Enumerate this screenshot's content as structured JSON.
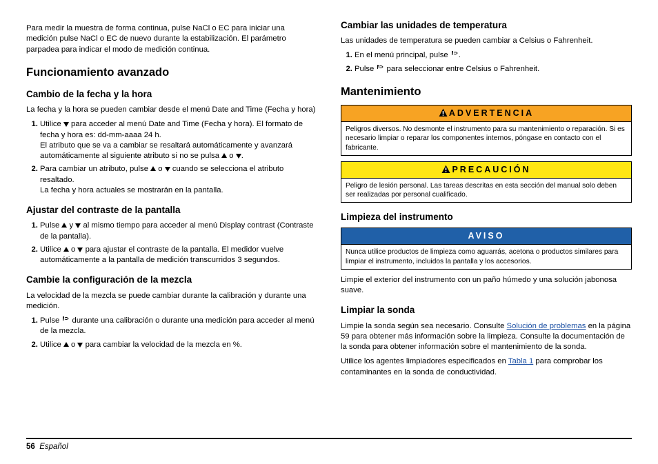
{
  "left": {
    "intro": "Para medir la muestra de forma continua, pulse NaCl o EC para iniciar una medición pulse NaCl o EC de nuevo durante la estabilización. El parámetro parpadea para indicar el modo de medición continua.",
    "h1": "Funcionamiento avanzado",
    "sec1": {
      "title": "Cambio de la fecha y la hora",
      "p1": "La fecha y la hora se pueden cambiar desde el menú Date and Time (Fecha y hora)",
      "li1a": "Utilice ",
      "li1b": " para acceder al menú Date and Time (Fecha y hora). El formato de fecha y hora es: dd-mm-aaaa 24 h.",
      "li1c": "El atributo que se va a cambiar se resaltará automáticamente y avanzará automáticamente al siguiente atributo si no se pulsa ",
      "li1d": " o ",
      "li1e": ".",
      "li2a": "Para cambiar un atributo, pulse ",
      "li2b": " o ",
      "li2c": " cuando se selecciona el atributo resaltado.",
      "li2d": "La fecha y hora actuales se mostrarán en la pantalla."
    },
    "sec2": {
      "title": "Ajustar del contraste de la pantalla",
      "li1a": "Pulse ",
      "li1b": " y ",
      "li1c": " al mismo tiempo para acceder al menú Display contrast (Contraste de la pantalla).",
      "li2a": "Utilice ",
      "li2b": " o ",
      "li2c": " para ajustar el contraste de la pantalla. El medidor vuelve automáticamente a la pantalla de medición transcurridos 3 segundos."
    },
    "sec3": {
      "title": "Cambie la configuración de la mezcla",
      "p1": "La velocidad de la mezcla se puede cambiar durante la calibración y durante una medición.",
      "li1a": "Pulse ",
      "li1b": " durante una calibración o durante una medición para acceder al menú de la mezcla.",
      "li2a": "Utilice ",
      "li2b": " o ",
      "li2c": " para cambiar la velocidad de la mezcla en %."
    }
  },
  "right": {
    "sec1": {
      "title": "Cambiar las unidades de temperatura",
      "p1": "Las unidades de temperatura se pueden cambiar a Celsius o Fahrenheit.",
      "li1a": "En el menú principal, pulse ",
      "li1b": ".",
      "li2a": "Pulse ",
      "li2b": " para seleccionar entre Celsius o Fahrenheit."
    },
    "h1": "Mantenimiento",
    "warn1": {
      "title": "ADVERTENCIA",
      "body": "Peligros diversos. No desmonte el instrumento para su mantenimiento o reparación. Si es necesario limpiar o reparar los componentes internos, póngase en contacto con el fabricante."
    },
    "warn2": {
      "title": "PRECAUCIÓN",
      "body": "Peligro de lesión personal. Las tareas descritas en esta sección del manual solo deben ser realizadas por personal cualificado."
    },
    "sec2": {
      "title": "Limpieza del instrumento",
      "noticeTitle": "AVISO",
      "noticeBody": "Nunca utilice productos de limpieza como aguarrás, acetona o productos similares para limpiar el instrumento, incluidos la pantalla y los accesorios.",
      "p1": "Limpie el exterior del instrumento con un paño húmedo y una solución jabonosa suave."
    },
    "sec3": {
      "title": "Limpiar la sonda",
      "p1a": "Limpie la sonda según sea necesario. Consulte ",
      "link1": "Solución de problemas",
      "p1b": " en la página 59 para obtener más información sobre la limpieza. Consulte la documentación de la sonda para obtener información sobre el mantenimiento de la sonda.",
      "p2a": "Utilice los agentes limpiadores especificados en ",
      "link2": "Tabla 1",
      "p2b": " para comprobar los contaminantes en la sonda de conductividad."
    }
  },
  "footer": {
    "pageNum": "56",
    "lang": "Español"
  }
}
